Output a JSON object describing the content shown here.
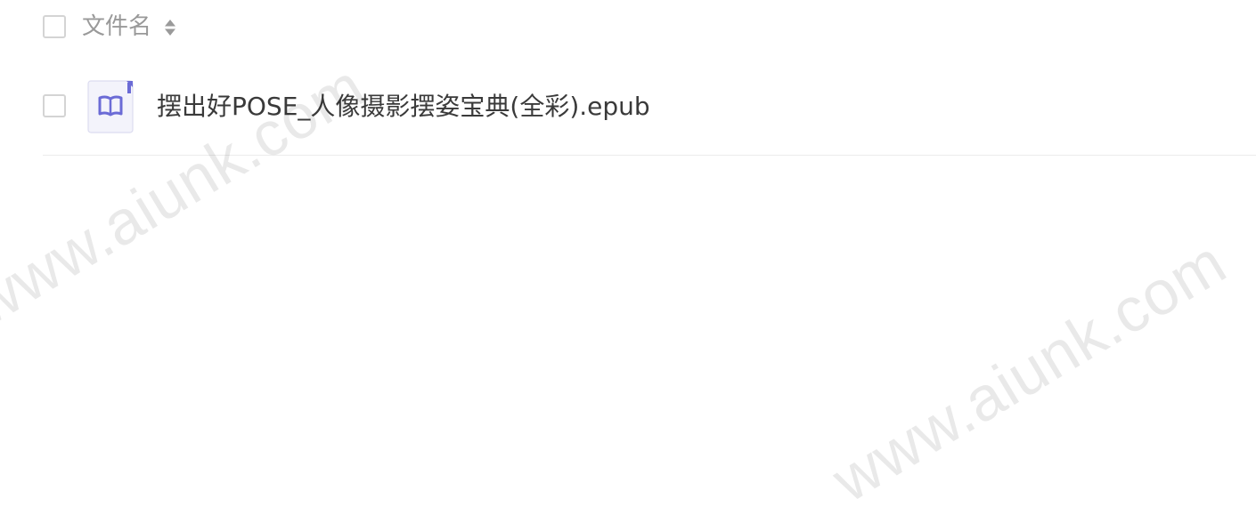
{
  "file_list": {
    "header": {
      "column_label": "文件名",
      "sort_icon": "sort-updown-icon"
    },
    "rows": [
      {
        "file_icon": "epub-book-icon",
        "name": "摆出好POSE_人像摄影摆姿宝典(全彩).epub"
      }
    ]
  },
  "watermarks": [
    "www.aiunk.com",
    "www.aiunk.com"
  ],
  "colors": {
    "background": "#ffffff",
    "text": "#3a3a3a",
    "muted_text": "#999999",
    "checkbox_border": "#d4d4d4",
    "icon_accent": "#6b6bd6",
    "icon_bg": "#f3f3fb",
    "divider": "#ececec"
  }
}
